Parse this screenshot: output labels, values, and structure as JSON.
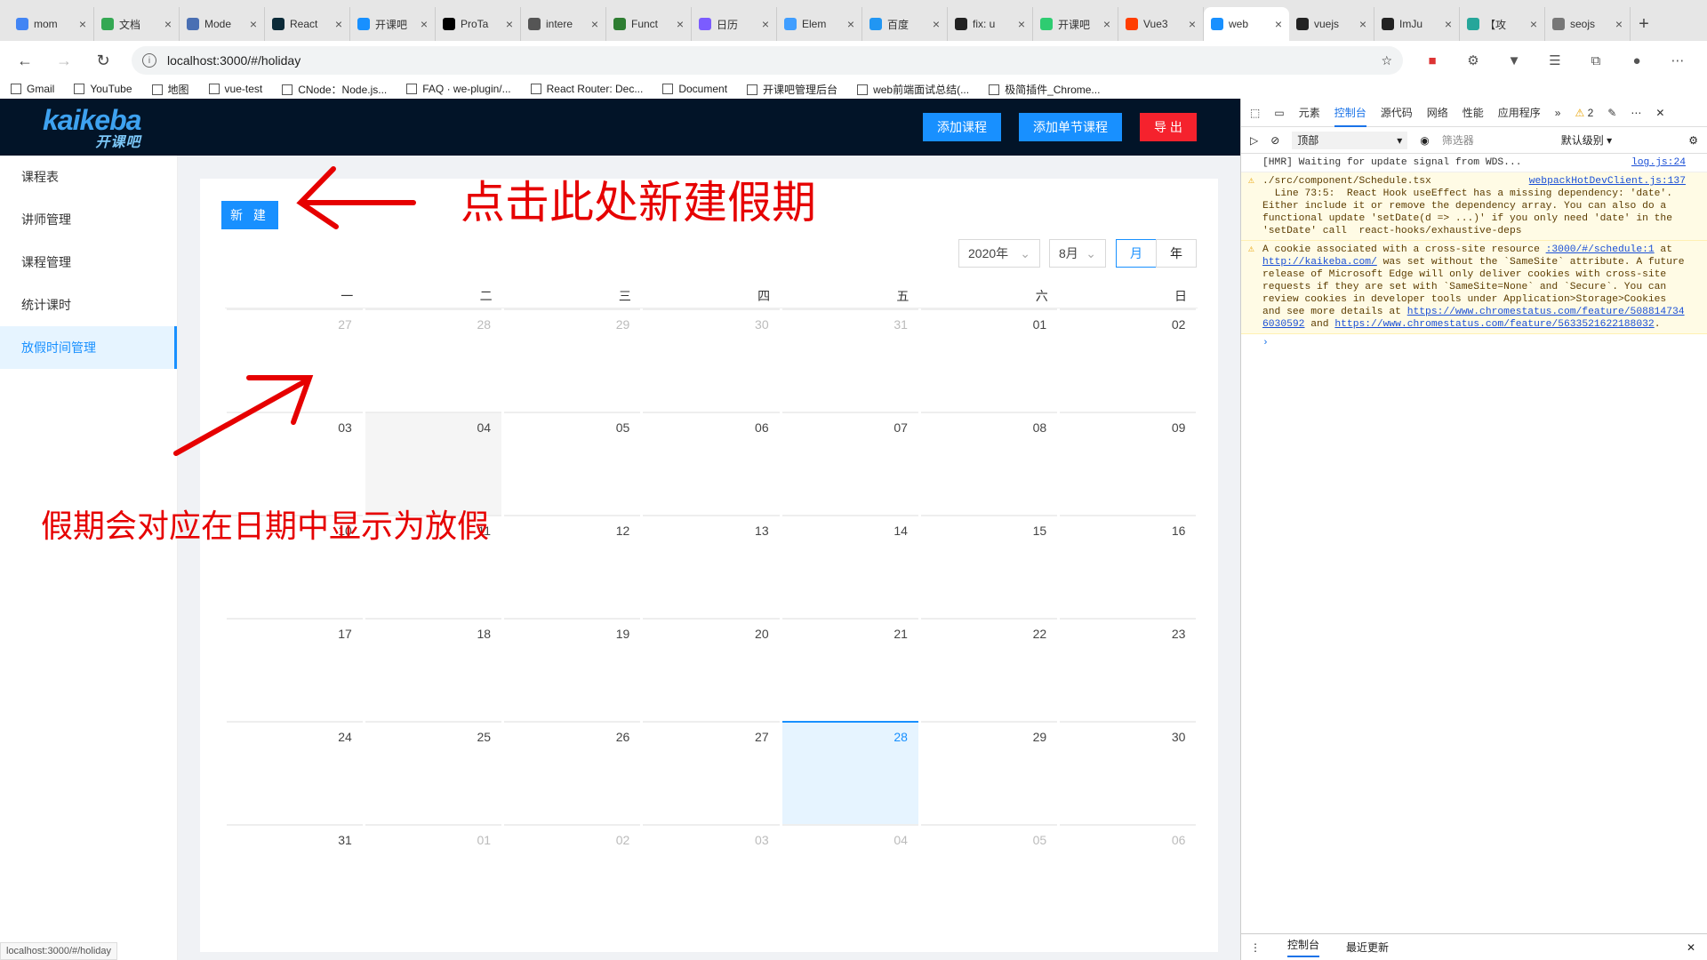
{
  "tabs": [
    {
      "title": "mom",
      "color": "#4285f4"
    },
    {
      "title": "文档",
      "color": "#34a853"
    },
    {
      "title": "Mode",
      "color": "#4a6fb3"
    },
    {
      "title": "React",
      "color": "#0b2a38"
    },
    {
      "title": "开课吧",
      "color": "#1890ff"
    },
    {
      "title": "ProTa",
      "color": "#000000"
    },
    {
      "title": "intere",
      "color": "#555555"
    },
    {
      "title": "Funct",
      "color": "#2e7d32"
    },
    {
      "title": "日历",
      "color": "#7b5cff"
    },
    {
      "title": "Elem",
      "color": "#409eff"
    },
    {
      "title": "百度",
      "color": "#2196f3"
    },
    {
      "title": "fix: u",
      "color": "#222222"
    },
    {
      "title": "开课吧",
      "color": "#2ecc71"
    },
    {
      "title": "Vue3",
      "color": "#ff3d00"
    },
    {
      "title": "web",
      "color": "#1890ff",
      "active": true
    },
    {
      "title": "vuejs",
      "color": "#222222"
    },
    {
      "title": "ImJu",
      "color": "#222222"
    },
    {
      "title": "【攻",
      "color": "#26a69a"
    },
    {
      "title": "seojs",
      "color": "#777777"
    }
  ],
  "address": {
    "url": "localhost:3000/#/holiday"
  },
  "bookmarks": [
    "Gmail",
    "YouTube",
    "地图",
    "vue-test",
    "CNode：Node.js...",
    "FAQ · we-plugin/...",
    "React Router: Dec...",
    "Document",
    "开课吧管理后台",
    "web前端面试总结(...",
    "极简插件_Chrome..."
  ],
  "app": {
    "logo": "kaikeba",
    "logo_sub": "开课吧",
    "buttons": {
      "add_course": "添加课程",
      "add_lesson": "添加单节课程",
      "export": "导 出"
    },
    "menu": [
      "课程表",
      "讲师管理",
      "课程管理",
      "统计课时",
      "放假时间管理"
    ],
    "new_button": "新 建",
    "year": "2020年",
    "month": "8月",
    "mode_month": "月",
    "mode_year": "年",
    "weekdays": [
      "一",
      "二",
      "三",
      "四",
      "五",
      "六",
      "日"
    ],
    "weeks": [
      [
        "27",
        "28",
        "29",
        "30",
        "31",
        "01",
        "02"
      ],
      [
        "03",
        "04",
        "05",
        "06",
        "07",
        "08",
        "09"
      ],
      [
        "10",
        "11",
        "12",
        "13",
        "14",
        "15",
        "16"
      ],
      [
        "17",
        "18",
        "19",
        "20",
        "21",
        "22",
        "23"
      ],
      [
        "24",
        "25",
        "26",
        "27",
        "28",
        "29",
        "30"
      ],
      [
        "31",
        "01",
        "02",
        "03",
        "04",
        "05",
        "06"
      ]
    ]
  },
  "annotations": {
    "top": "点击此处新建假期",
    "bottom": "假期会对应在日期中显示为放假"
  },
  "devtools": {
    "tabs": [
      "元素",
      "控制台",
      "源代码",
      "网络",
      "性能",
      "应用程序"
    ],
    "warn_count": "2",
    "context": "顶部",
    "filter": "筛选器",
    "level": "默认级别",
    "log1": "[HMR] Waiting for update signal from WDS...",
    "log1_src": "log.js:24",
    "warn1_src": "webpackHotDevClient.js:137",
    "warn1": "./src/component/Schedule.tsx\n  Line 73:5:  React Hook useEffect has a missing dependency: 'date'. Either include it or remove the dependency array. You can also do a functional update 'setDate(d => ...)' if you only need 'date' in the 'setDate' call  react-hooks/exhaustive-deps",
    "warn2_a": "A cookie associated with a cross-site resource ",
    "warn2_link1": ":3000/#/schedule:1",
    "warn2_b": " at ",
    "warn2_link2": "http://kaikeba.com/",
    "warn2_c": " was set without the `SameSite` attribute. A future release of Microsoft Edge will only deliver cookies with cross-site requests if they are set with `SameSite=None` and `Secure`. You can review cookies in developer tools under Application>Storage>Cookies and see more details at ",
    "warn2_link3": "https://www.chromestatus.com/feature/5088147346030592",
    "warn2_d": " and ",
    "warn2_link4": "https://www.chromestatus.com/feature/5633521622188032",
    "warn2_e": ".",
    "footer": [
      "控制台",
      "最近更新"
    ]
  },
  "status_url": "localhost:3000/#/holiday"
}
